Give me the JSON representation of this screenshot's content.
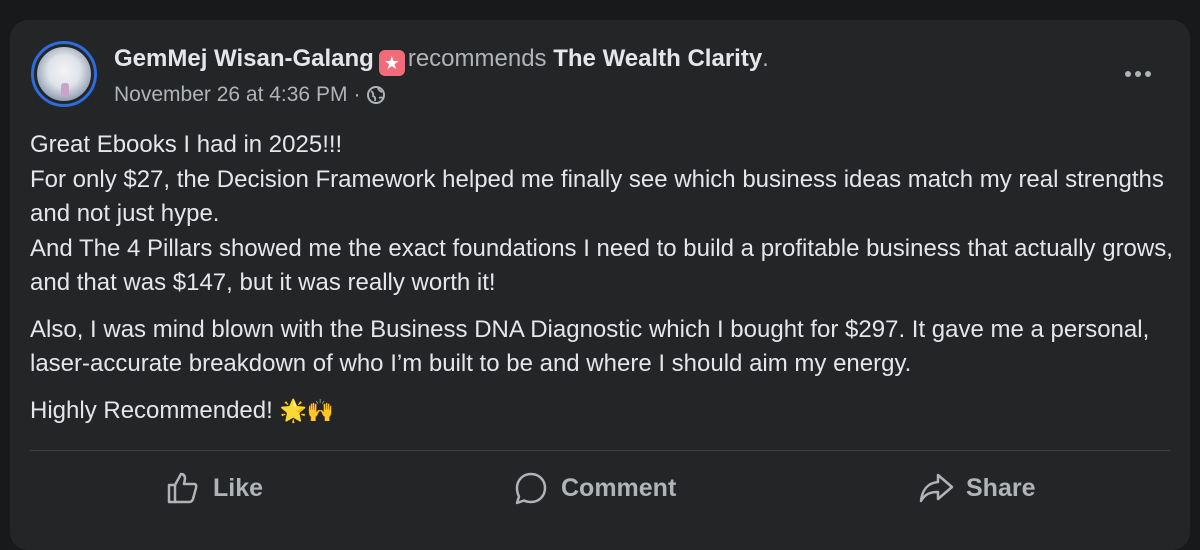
{
  "post": {
    "author": "GemMej Wisan-Galang",
    "badge_icon": "star-badge-icon",
    "action": "recommends",
    "page_name": "The Wealth Clarity",
    "period": ".",
    "timestamp": "November 26 at 4:36 PM",
    "separator": "·",
    "privacy_icon": "globe-icon",
    "body": {
      "p1_line1": "Great Ebooks I had in 2025!!!",
      "p1_line2": "For only $27, the Decision Framework helped me finally see which business ideas match my real strengths and not just hype.",
      "p1_line3": "And The 4 Pillars showed me the exact foundations I need to build a profitable business that actually grows, and that was $147, but it was really worth it!",
      "p2": "Also, I was mind blown with the Business DNA Diagnostic which I bought for $297. It gave me a personal, laser-accurate breakdown of who I’m built to be and where I should aim my energy.",
      "p3": "Highly Recommended!",
      "p3_emoji": "🌟🙌"
    }
  },
  "actions": {
    "like": "Like",
    "comment": "Comment",
    "share": "Share"
  },
  "colors": {
    "background": "#18191a",
    "card": "#242526",
    "primary_text": "#e4e6eb",
    "secondary_text": "#b0b3b8",
    "badge": "#f26b7a",
    "avatar_ring": "#2d6cdf"
  }
}
